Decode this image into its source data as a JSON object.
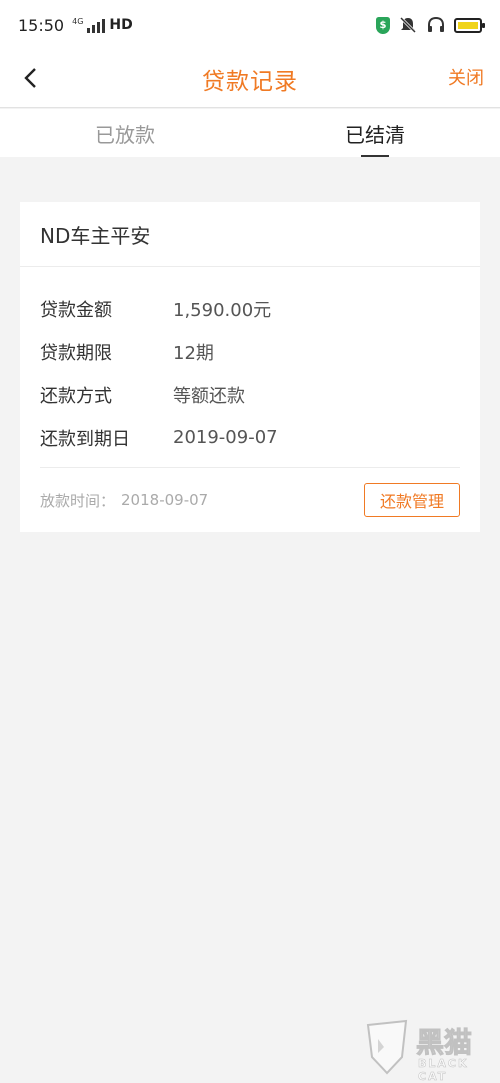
{
  "status_bar": {
    "time": "15:50",
    "network": "4G",
    "hd": "HD",
    "colors": {
      "shield": "#2aa55a",
      "battery": "#f0d41b"
    }
  },
  "nav": {
    "back_icon": "chevron-left-icon",
    "title": "贷款记录",
    "close_label": "关闭",
    "accent_color": "#f07a24"
  },
  "tabs": [
    {
      "label": "已放款",
      "active": false
    },
    {
      "label": "已结清",
      "active": true
    }
  ],
  "loan_card": {
    "title": "ND车主平安",
    "rows": [
      {
        "label": "贷款金额",
        "value": "1,590.00元"
      },
      {
        "label": "贷款期限",
        "value": "12期"
      },
      {
        "label": "还款方式",
        "value": "等额还款"
      },
      {
        "label": "还款到期日",
        "value": "2019-09-07"
      }
    ],
    "footer": {
      "label": "放款时间：",
      "date": "2018-09-07",
      "button_label": "还款管理"
    }
  },
  "watermark": {
    "text": "黑猫",
    "subtext": "BLACK CAT"
  }
}
